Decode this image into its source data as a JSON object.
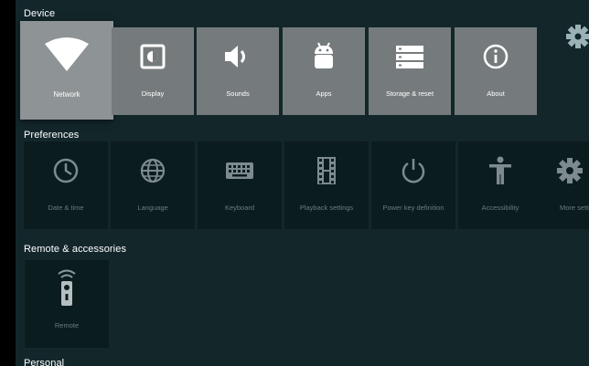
{
  "sections": {
    "device": "Device",
    "preferences": "Preferences",
    "remote": "Remote & accessories",
    "personal": "Personal"
  },
  "device_tiles": {
    "network": "Network",
    "display": "Display",
    "sounds": "Sounds",
    "apps": "Apps",
    "storage": "Storage & reset",
    "about": "About"
  },
  "preference_tiles": {
    "datetime": "Date & time",
    "language": "Language",
    "keyboard": "Keyboard",
    "playback": "Playback settings",
    "powerkey": "Power key definition",
    "accessibility": "Accessibility",
    "more": "More settings"
  },
  "remote_tiles": {
    "remote": "Remote"
  },
  "colors": {
    "background": "#13272b",
    "tile_device": "#757b7d",
    "tile_device_focused": "#8e9395",
    "tile_preference": "#0b1c1f",
    "accent_gear": "#9ab2b6"
  },
  "focused_tile": "Network"
}
